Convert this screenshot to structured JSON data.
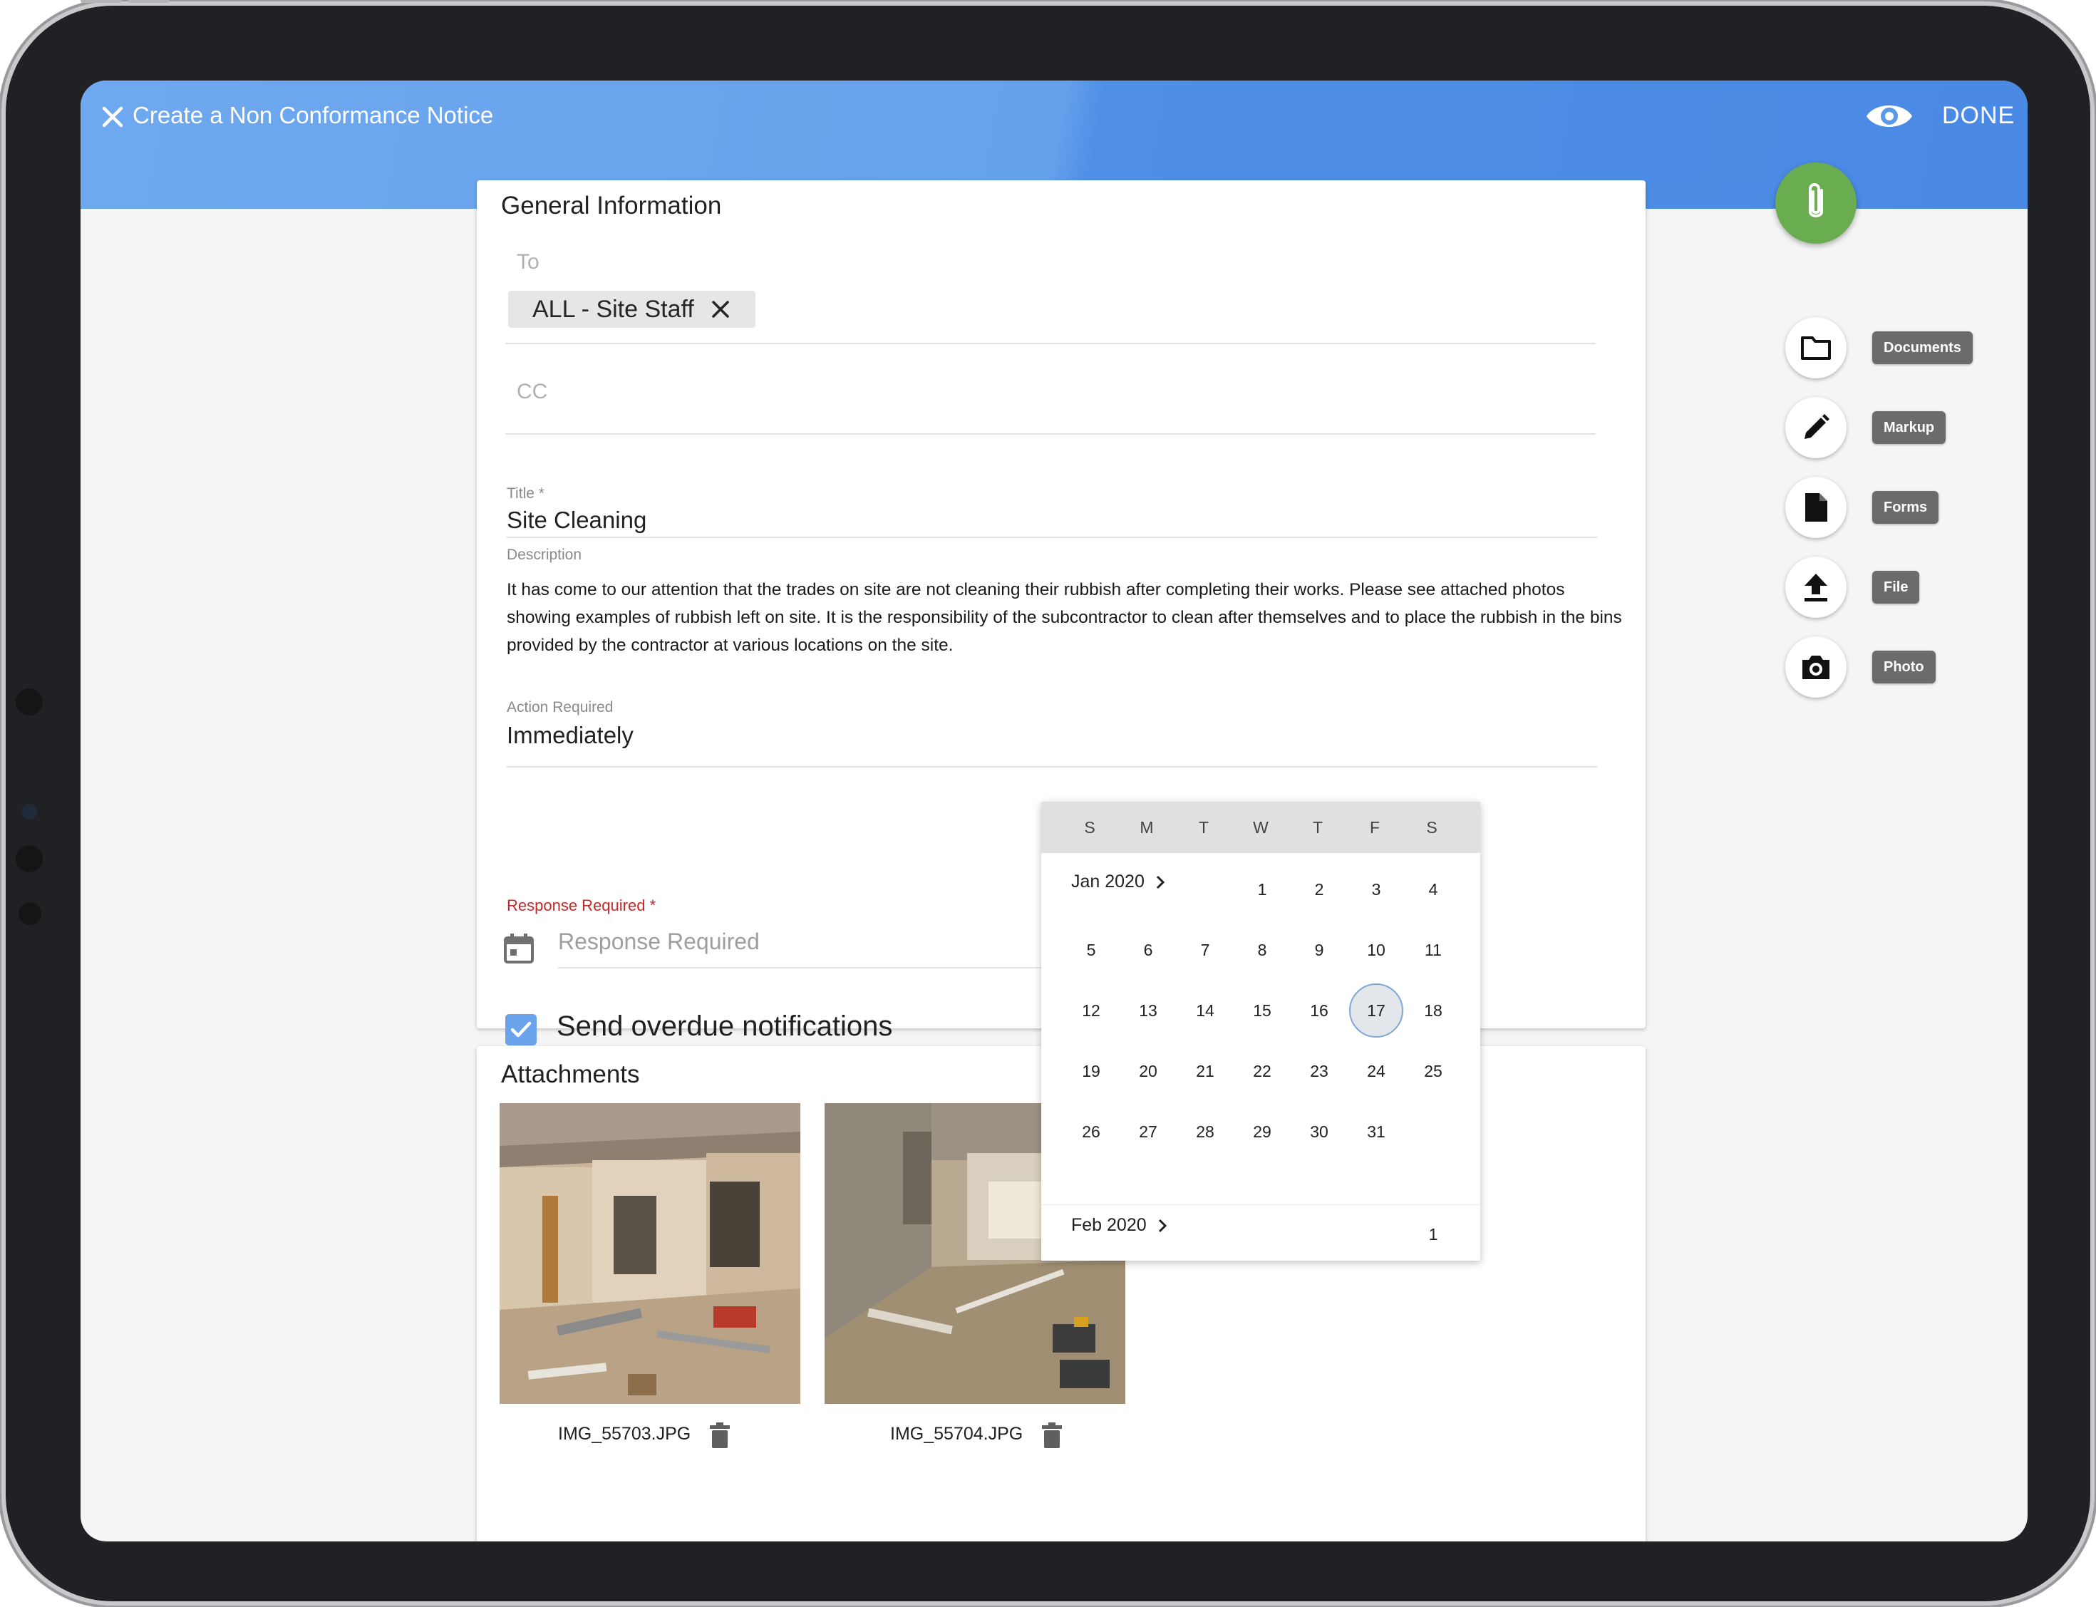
{
  "header": {
    "title": "Create a Non Conformance Notice",
    "done_label": "DONE"
  },
  "general": {
    "title": "General Information",
    "to_label": "To",
    "to_chip": "ALL - Site Staff",
    "cc_label": "CC",
    "title_label": "Title *",
    "title_value": "Site Cleaning",
    "description_label": "Description",
    "description_value": "It has come to our attention that the trades on site are not cleaning their rubbish after completing their works. Please see attached photos showing examples of rubbish left on site. It is the responsibility of the subcontractor to clean after themselves and to place the rubbish in the bins provided by the contractor at various locations on the site.",
    "action_label": "Action Required",
    "action_value": "Immediately",
    "response_label": "Response Required *",
    "response_placeholder": "Response Required",
    "overdue_label": "Send overdue notifications",
    "overdue_checked": true
  },
  "attachments": {
    "title": "Attachments",
    "files": [
      {
        "name": "IMG_55703.JPG"
      },
      {
        "name": "IMG_55704.JPG"
      }
    ]
  },
  "tools": [
    {
      "label": "Documents",
      "icon": "folder-icon"
    },
    {
      "label": "Markup",
      "icon": "pencil-icon"
    },
    {
      "label": "Forms",
      "icon": "document-icon"
    },
    {
      "label": "File",
      "icon": "upload-icon"
    },
    {
      "label": "Photo",
      "icon": "camera-icon"
    }
  ],
  "calendar": {
    "weekdays": [
      "S",
      "M",
      "T",
      "W",
      "T",
      "F",
      "S"
    ],
    "month1": "Jan 2020",
    "month2": "Feb 2020",
    "selected_day": "17",
    "jan_days": [
      "1",
      "2",
      "3",
      "4",
      "5",
      "6",
      "7",
      "8",
      "9",
      "10",
      "11",
      "12",
      "13",
      "14",
      "15",
      "16",
      "17",
      "18",
      "19",
      "20",
      "21",
      "22",
      "23",
      "24",
      "25",
      "26",
      "27",
      "28",
      "29",
      "30",
      "31"
    ],
    "feb_days": [
      "1"
    ]
  },
  "colors": {
    "header_blue": "#5a98ea",
    "fab_green": "#6aac50",
    "required_red": "#c62828",
    "checkbox_blue": "#6aa3ec"
  }
}
